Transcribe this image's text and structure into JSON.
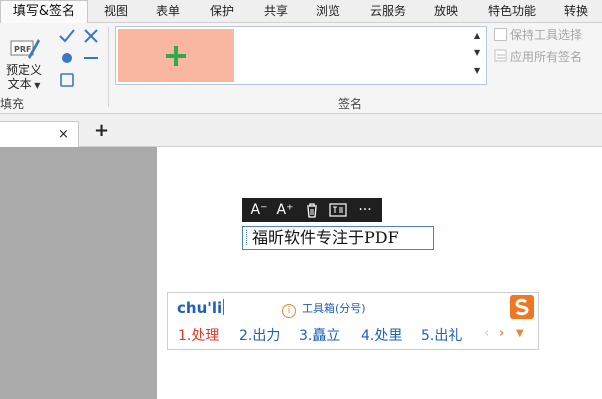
{
  "ribbon_tabs": [
    {
      "label": "填写&签名",
      "active": true
    },
    {
      "label": "视图"
    },
    {
      "label": "表单"
    },
    {
      "label": "保护"
    },
    {
      "label": "共享"
    },
    {
      "label": "浏览"
    },
    {
      "label": "云服务"
    },
    {
      "label": "放映"
    },
    {
      "label": "特色功能"
    },
    {
      "label": "转换"
    }
  ],
  "fill_group": {
    "predefined_text_line1": "预定义",
    "predefined_text_line2": "文本",
    "group_label": "填充",
    "prf_icon_text": "PRF"
  },
  "sign_group": {
    "group_label": "签名",
    "options": [
      {
        "label": "保持工具选择",
        "checked": false
      },
      {
        "label": "应用所有签名",
        "checked": false
      }
    ],
    "add_color": "#f9b7a2",
    "plus_color": "#2eaa4f"
  },
  "document": {
    "close_glyph": "×",
    "new_tab_glyph": "+"
  },
  "text_toolbar": {
    "decrease_font": "A⁻",
    "increase_font": "A⁺",
    "more": "···"
  },
  "textbox": {
    "content": "福昕软件专注于PDF"
  },
  "ime": {
    "input": "chu'li",
    "tip": "工具箱(分号)",
    "candidates": [
      "1.处理",
      "2.出力",
      "3.矗立",
      "4.处里",
      "5.出礼"
    ],
    "accent": "#e03a2a",
    "text_color": "#1f5fbf"
  }
}
